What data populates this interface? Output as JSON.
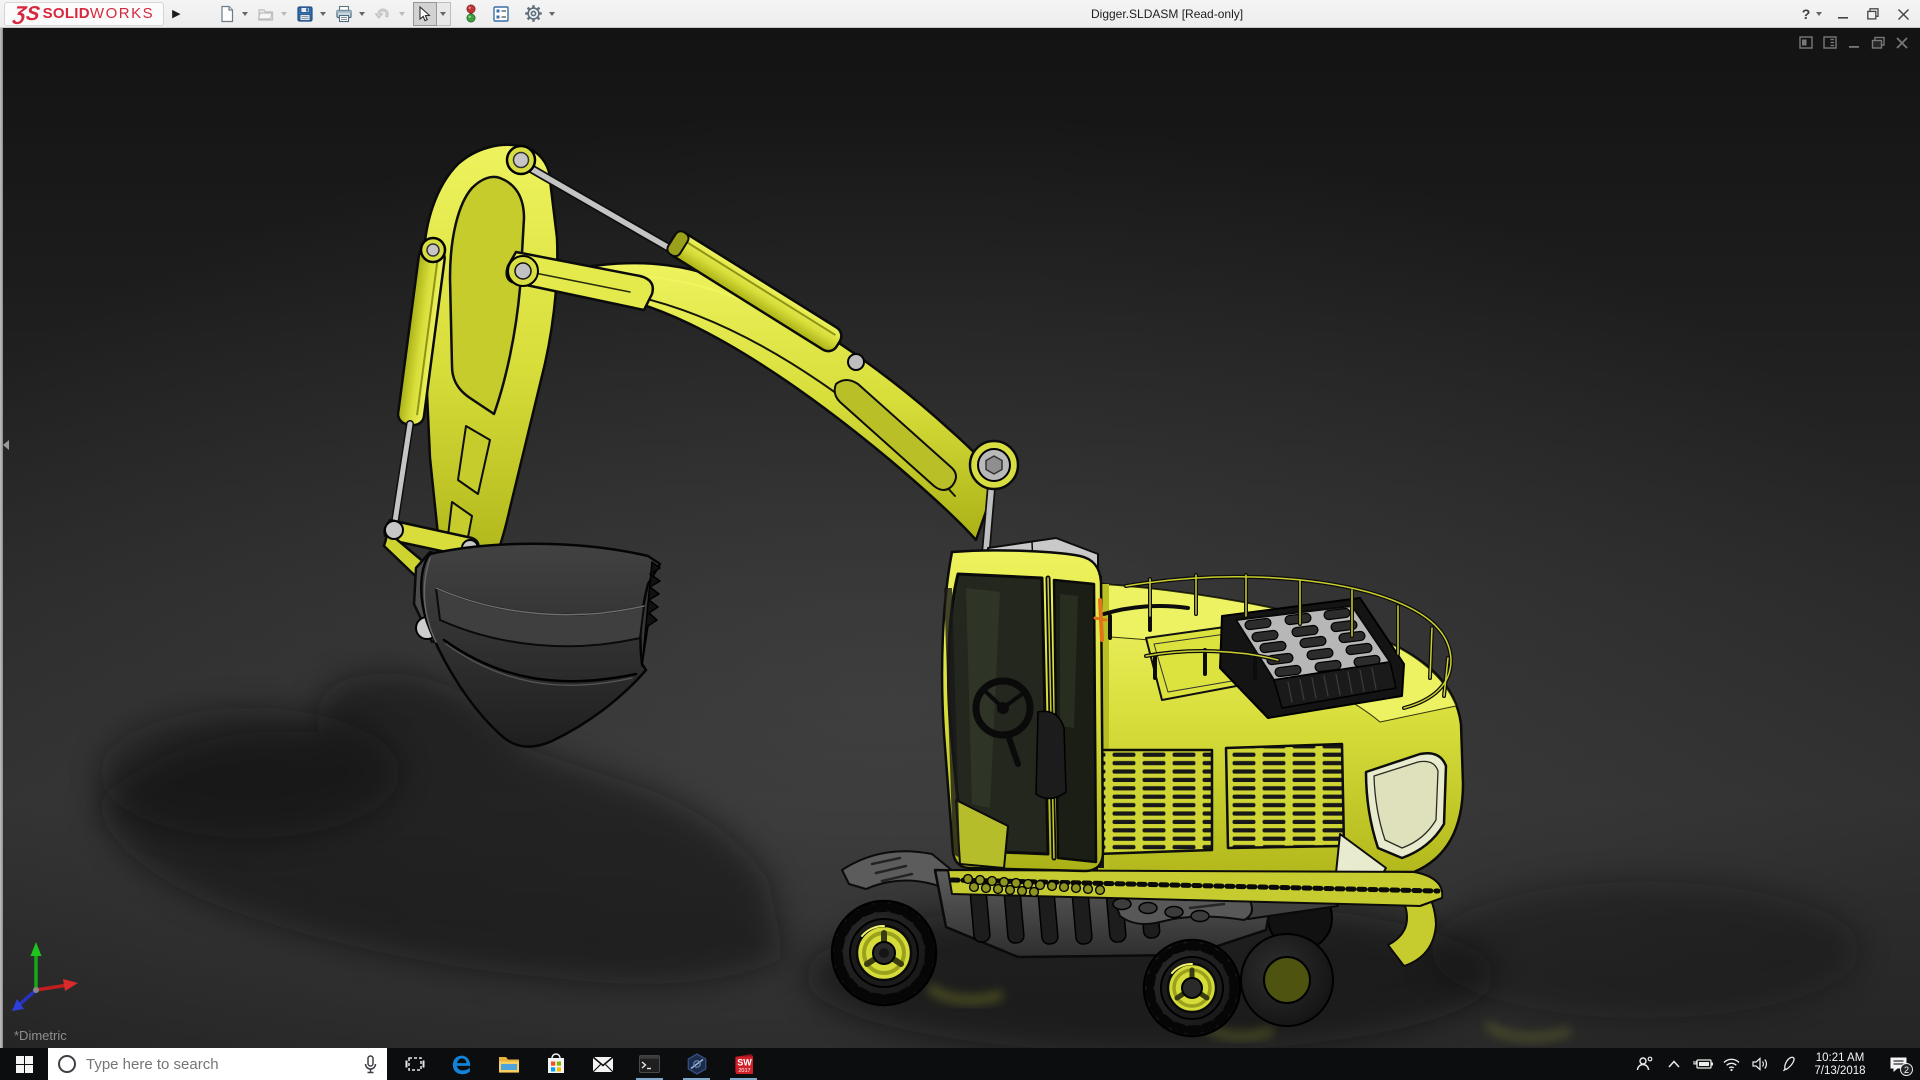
{
  "window": {
    "title": "Digger.SLDASM [Read-only]",
    "help_glyph": "?",
    "controls": [
      "minimize-icon",
      "restore-icon",
      "close-icon"
    ]
  },
  "brand": {
    "glyph": "ƷS",
    "solid": "SOLID",
    "works": "WORKS"
  },
  "toolbar": {
    "items": [
      "new-document",
      "open",
      "save",
      "print",
      "undo",
      "select",
      "rebuild",
      "file-properties",
      "options"
    ],
    "disabled": [
      "open",
      "undo"
    ],
    "active": "select"
  },
  "viewport": {
    "view_orientation": "*Dimetric",
    "model_name": "Digger",
    "window_controls": [
      "doc-window-icon-a",
      "doc-window-icon-b",
      "minimize-icon",
      "restore-icon",
      "close-icon"
    ],
    "triad_axes": [
      "y-green-up",
      "x-red-right",
      "z-blue-lower-left"
    ]
  },
  "taskbar": {
    "search_placeholder": "Type here to search",
    "apps": [
      "task-view",
      "edge",
      "file-explorer",
      "store",
      "mail",
      "command-prompt",
      "cad-viewer",
      "solidworks-2017"
    ],
    "running_apps": [
      "command-prompt",
      "cad-viewer",
      "solidworks-2017"
    ],
    "sw_label": "SW",
    "sw_year": "2017",
    "tray": [
      "people",
      "hidden-icons",
      "battery",
      "network",
      "volume",
      "pen"
    ],
    "clock": {
      "time": "10:21 AM",
      "date": "7/13/2018"
    },
    "action_center_badge": "2"
  },
  "colors": {
    "brand_red": "#d6283e",
    "titlebar_bg": "#f2f2f2",
    "viewport_bg": "#2a2a2a",
    "model_yellow": "#d8de3a",
    "selection_orange": "#e2761e",
    "taskbar_bg": "#0b0d0f",
    "running_underline": "#7fa8cb",
    "store_squares": [
      "#f25022",
      "#7fba00",
      "#00a4ef",
      "#ffb900"
    ]
  }
}
